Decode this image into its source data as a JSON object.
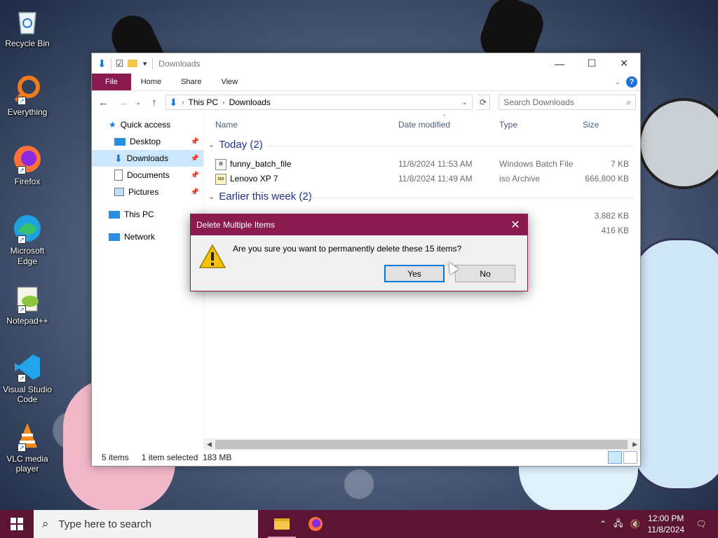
{
  "desktop": {
    "icons": [
      {
        "label": "Recycle Bin",
        "icon": "recycle-bin-icon"
      },
      {
        "label": "Everything",
        "icon": "everything-search-icon"
      },
      {
        "label": "Firefox",
        "icon": "firefox-icon"
      },
      {
        "label": "Microsoft Edge",
        "icon": "edge-icon"
      },
      {
        "label": "Notepad++",
        "icon": "notepad-plus-plus-icon"
      },
      {
        "label": "Visual Studio Code",
        "icon": "vscode-icon"
      },
      {
        "label": "VLC media player",
        "icon": "vlc-icon"
      }
    ]
  },
  "explorer": {
    "title": "Downloads",
    "ribbon": {
      "file": "File",
      "home": "Home",
      "share": "Share",
      "view": "View"
    },
    "address": {
      "root": "This PC",
      "current": "Downloads"
    },
    "search_placeholder": "Search Downloads",
    "sidebar": {
      "quick_access": "Quick access",
      "desktop": "Desktop",
      "downloads": "Downloads",
      "documents": "Documents",
      "pictures": "Pictures",
      "this_pc": "This PC",
      "network": "Network"
    },
    "columns": {
      "name": "Name",
      "date": "Date modified",
      "type": "Type",
      "size": "Size"
    },
    "groups": [
      {
        "label": "Today (2)",
        "files": [
          {
            "name": "funny_batch_file",
            "date": "11/8/2024 11:53 AM",
            "type": "Windows Batch File",
            "size": "7 KB"
          },
          {
            "name": "Lenovo XP 7",
            "date": "11/8/2024 11:49 AM",
            "type": "iso Archive",
            "size": "666,800 KB"
          }
        ]
      },
      {
        "label": "Earlier this week (2)",
        "files": [
          {
            "size": "3,882 KB"
          },
          {
            "size": "416 KB"
          }
        ]
      }
    ],
    "status": {
      "count": "5 items",
      "selected": "1 item selected",
      "selected_size": "183 MB"
    }
  },
  "dialog": {
    "title": "Delete Multiple Items",
    "message": "Are you sure you want to permanently delete these 15 items?",
    "yes": "Yes",
    "no": "No"
  },
  "taskbar": {
    "search_placeholder": "Type here to search",
    "time": "12:00 PM",
    "date": "11/8/2024"
  },
  "colors": {
    "accent": "#8b1a4e",
    "taskbar": "#5b1431",
    "selection": "#cce8ff"
  }
}
